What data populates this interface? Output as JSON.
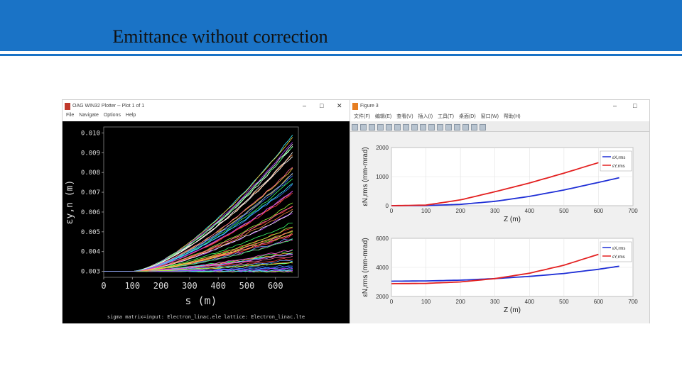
{
  "slide_title": "Emittance without correction",
  "left_window": {
    "title": "OAG WIN32 Plotter -- Plot 1 of 1",
    "menu": [
      "File",
      "Navigate",
      "Options",
      "Help"
    ],
    "plot": {
      "y_label": "εy,n (m)",
      "x_label": "s (m)",
      "y_ticks": [
        "0.003",
        "0.004",
        "0.005",
        "0.006",
        "0.007",
        "0.008",
        "0.009",
        "0.010"
      ],
      "x_ticks": [
        "0",
        "100",
        "200",
        "300",
        "400",
        "500",
        "600"
      ],
      "footer": "sigma matrix=input: Electron_linac.ele   lattice: Electron_linac.lte"
    }
  },
  "right_window": {
    "title": "Figure 3",
    "menu": [
      "文件(F)",
      "编辑(E)",
      "查看(V)",
      "插入(I)",
      "工具(T)",
      "桌面(D)",
      "窗口(W)",
      "帮助(H)"
    ],
    "toolbar_icons": [
      "new-icon",
      "open-icon",
      "save-icon",
      "print-icon",
      "pointer-icon",
      "zoom-in-icon",
      "zoom-out-icon",
      "pan-icon",
      "rotate-icon",
      "datatip-icon",
      "brush-icon",
      "link-icon",
      "colorbar-icon",
      "legend-icon",
      "hide-tools-icon",
      "dock-icon"
    ]
  },
  "colors": {
    "header": "#1a73c6",
    "series_x": "#1f2fd6",
    "series_y": "#e32020",
    "left_bg": "#000000"
  },
  "chart_data": [
    {
      "type": "line",
      "note_series": "many overlapping colored trajectories",
      "xlabel": "s (m)",
      "ylabel": "εy,n (m)",
      "xlim": [
        0,
        680
      ],
      "ylim": [
        0.0027,
        0.0103
      ],
      "grid": false,
      "background": "black",
      "start_value": 0.003,
      "start_flat_until": 100,
      "approx_series_count": 60,
      "max_end_value": 0.01,
      "min_end_value": 0.003
    },
    {
      "type": "line",
      "xlabel": "Z (m)",
      "ylabel": "εN,rms (mm-mrad)",
      "xlim": [
        0,
        700
      ],
      "ylim": [
        0,
        2000
      ],
      "grid": true,
      "legend": "top-right",
      "series": [
        {
          "name": "εX,rms",
          "color": "#1f2fd6",
          "x": [
            0,
            100,
            200,
            300,
            400,
            500,
            600,
            660
          ],
          "y": [
            0,
            5,
            45,
            150,
            320,
            540,
            800,
            960
          ]
        },
        {
          "name": "εY,rms",
          "color": "#e32020",
          "x": [
            0,
            100,
            200,
            300,
            400,
            500,
            600
          ],
          "y": [
            0,
            20,
            200,
            480,
            780,
            1120,
            1480
          ]
        }
      ]
    },
    {
      "type": "line",
      "xlabel": "Z (m)",
      "ylabel": "εN,rms (mm-mrad)",
      "xlim": [
        0,
        700
      ],
      "ylim": [
        2000,
        6000
      ],
      "grid": true,
      "legend": "top-right",
      "series": [
        {
          "name": "εX,rms",
          "color": "#1f2fd6",
          "x": [
            0,
            100,
            200,
            300,
            400,
            500,
            600,
            660
          ],
          "y": [
            3050,
            3070,
            3120,
            3230,
            3380,
            3580,
            3870,
            4080
          ]
        },
        {
          "name": "εY,rms",
          "color": "#e32020",
          "x": [
            0,
            100,
            200,
            300,
            400,
            500,
            600
          ],
          "y": [
            2880,
            2900,
            3000,
            3230,
            3600,
            4150,
            4900
          ]
        }
      ]
    }
  ]
}
